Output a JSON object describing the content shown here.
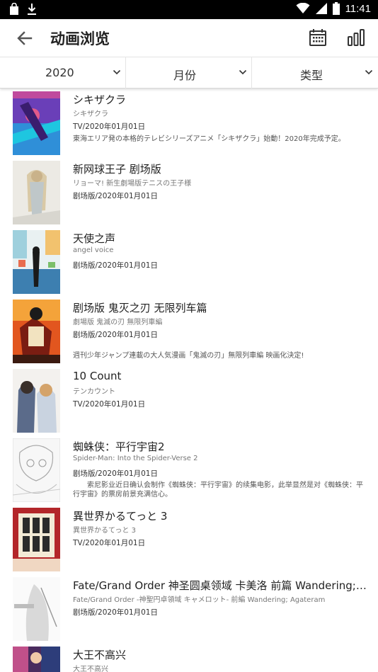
{
  "status_bar": {
    "time": "11:41"
  },
  "app_bar": {
    "title": "动画浏览"
  },
  "filters": [
    {
      "label": "2020"
    },
    {
      "label": "月份"
    },
    {
      "label": "类型"
    }
  ],
  "items": [
    {
      "title": "シキザクラ",
      "subtitle": "シキザクラ",
      "meta": "TV/2020年01月01日",
      "desc": "東海エリア発の本格的テレビシリーズアニメ「シキザクラ」始動！2020年完成予定。"
    },
    {
      "title": "新网球王子 剧场版",
      "subtitle": "リョーマ! 新生劇場版テニスの王子様",
      "meta": "剧场版/2020年01月01日",
      "desc": ""
    },
    {
      "title": "天使之声",
      "subtitle": "angel voice",
      "meta": "剧场版/2020年01月01日",
      "desc": ""
    },
    {
      "title": "剧场版 鬼灭之刃 无限列车篇",
      "subtitle": "劇場版 鬼滅の刃 無限列車編",
      "meta": "剧场版/2020年01月01日",
      "desc": "週刊少年ジャンプ連載の大人気漫画「鬼滅の刃」無限列車編 映画化決定!"
    },
    {
      "title": "10 Count",
      "subtitle": "テンカウント",
      "meta": "TV/2020年01月01日",
      "desc": ""
    },
    {
      "title": "蜘蛛侠：平行宇宙2",
      "subtitle": "Spider-Man: Into the Spider-Verse 2",
      "meta": "剧场版/2020年01月01日",
      "desc": "　　索尼影业近日确认会制作《蜘蛛侠：平行宇宙》的续集电影，此举显然是对《蜘蛛侠：平行宇宙》的票房前景充满信心。"
    },
    {
      "title": "異世界かるてっと 3",
      "subtitle": "異世界かるてっと 3",
      "meta": "TV/2020年01月01日",
      "desc": ""
    },
    {
      "title": "Fate/Grand Order 神圣圆桌领域 卡美洛 前篇 Wandering; Agateram",
      "subtitle": "Fate/Grand Order -神聖円卓領域 キャメロット- 前編 Wandering; Agateram",
      "meta": "剧场版/2020年01月01日",
      "desc": ""
    },
    {
      "title": "大王不高兴",
      "subtitle": "大王不高兴",
      "meta": "",
      "desc": ""
    }
  ],
  "colors": {
    "status_bar": "#000000",
    "accent": "#333333",
    "text": "#222222",
    "muted": "#777777"
  }
}
